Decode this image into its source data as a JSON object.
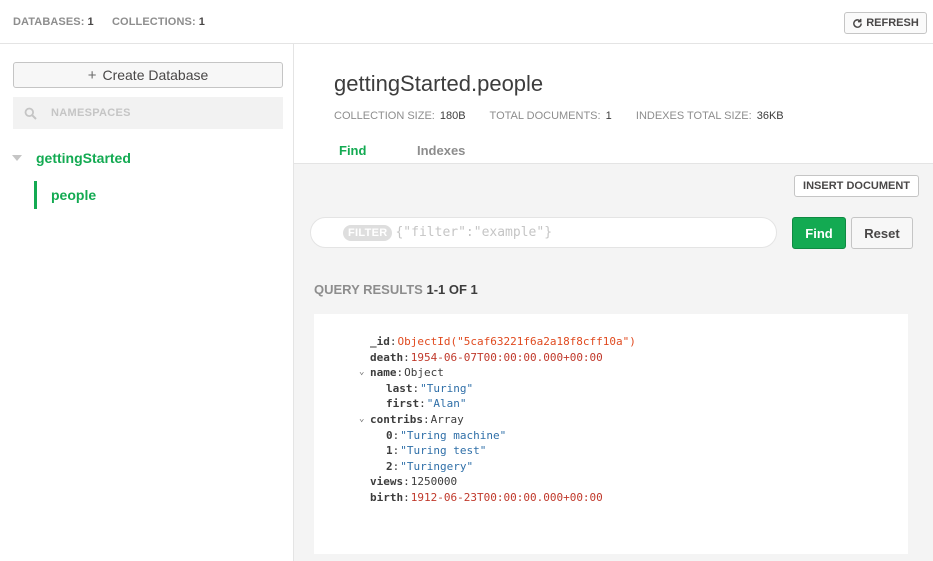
{
  "topbar": {
    "databases_label": "DATABASES:",
    "databases_count": "1",
    "collections_label": "COLLECTIONS:",
    "collections_count": "1",
    "refresh_label": "REFRESH"
  },
  "sidebar": {
    "create_db_label": "Create Database",
    "namespace_placeholder": "NAMESPACES",
    "database": "gettingStarted",
    "collection": "people"
  },
  "collection": {
    "title": "gettingStarted.people",
    "size_label": "COLLECTION SIZE:",
    "size_value": "180B",
    "docs_label": "TOTAL DOCUMENTS:",
    "docs_value": "1",
    "indexes_label": "INDEXES TOTAL SIZE:",
    "indexes_value": "36KB"
  },
  "tabs": {
    "find": "Find",
    "indexes": "Indexes"
  },
  "toolbar": {
    "insert_label": "INSERT DOCUMENT",
    "filter_badge": "FILTER",
    "filter_placeholder": "{\"filter\":\"example\"}",
    "find_label": "Find",
    "reset_label": "Reset"
  },
  "results": {
    "label": "QUERY RESULTS",
    "count": "1-1 OF 1"
  },
  "document": {
    "id_key": "_id",
    "id_value": "ObjectId(\"5caf63221f6a2a18f8cff10a\")",
    "death_key": "death",
    "death_value": "1954-06-07T00:00:00.000+00:00",
    "name_key": "name",
    "name_type": "Object",
    "last_key": "last",
    "last_value": "\"Turing\"",
    "first_key": "first",
    "first_value": "\"Alan\"",
    "contribs_key": "contribs",
    "contribs_type": "Array",
    "c0_key": "0",
    "c0_value": "\"Turing machine\"",
    "c1_key": "1",
    "c1_value": "\"Turing test\"",
    "c2_key": "2",
    "c2_value": "\"Turingery\"",
    "views_key": "views",
    "views_value": "1250000",
    "birth_key": "birth",
    "birth_value": "1912-06-23T00:00:00.000+00:00"
  }
}
